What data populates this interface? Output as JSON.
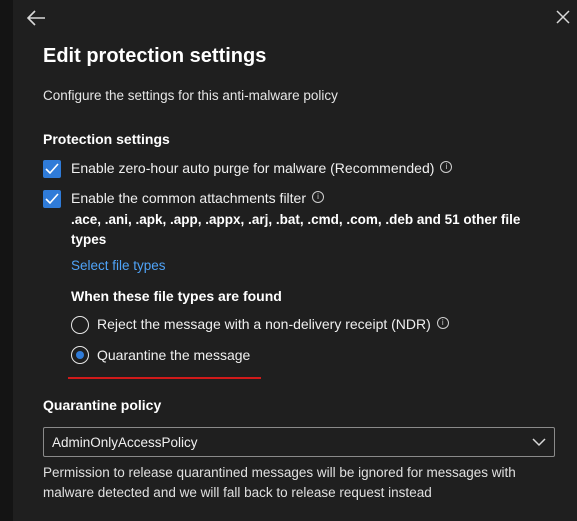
{
  "header": {
    "title": "Edit protection settings",
    "subtitle": "Configure the settings for this anti-malware policy"
  },
  "protection": {
    "heading": "Protection settings",
    "zap_label": "Enable zero-hour auto purge for malware (Recommended)",
    "zap_checked": true,
    "attachments_label": "Enable the common attachments filter",
    "attachments_checked": true,
    "file_types_summary": ".ace, .ani, .apk, .app, .appx, .arj, .bat, .cmd, .com, .deb and 51 other file types",
    "select_file_types_link": "Select file types",
    "found_heading": "When these file types are found",
    "options": [
      {
        "label": "Reject the message with a non-delivery receipt (NDR)",
        "selected": false
      },
      {
        "label": "Quarantine the message",
        "selected": true
      }
    ]
  },
  "quarantine": {
    "heading": "Quarantine policy",
    "selected_value": "AdminOnlyAccessPolicy",
    "note": "Permission to release quarantined messages will be ignored for messages with malware detected and we will fall back to release request instead"
  },
  "colors": {
    "accent": "#2f7bd8",
    "link": "#4fa3f7",
    "highlight_underline": "#d11a1a",
    "background": "#1f1f1f"
  },
  "icons": [
    "back-arrow-icon",
    "close-icon",
    "checkmark-icon",
    "info-icon",
    "chevron-down-icon"
  ]
}
